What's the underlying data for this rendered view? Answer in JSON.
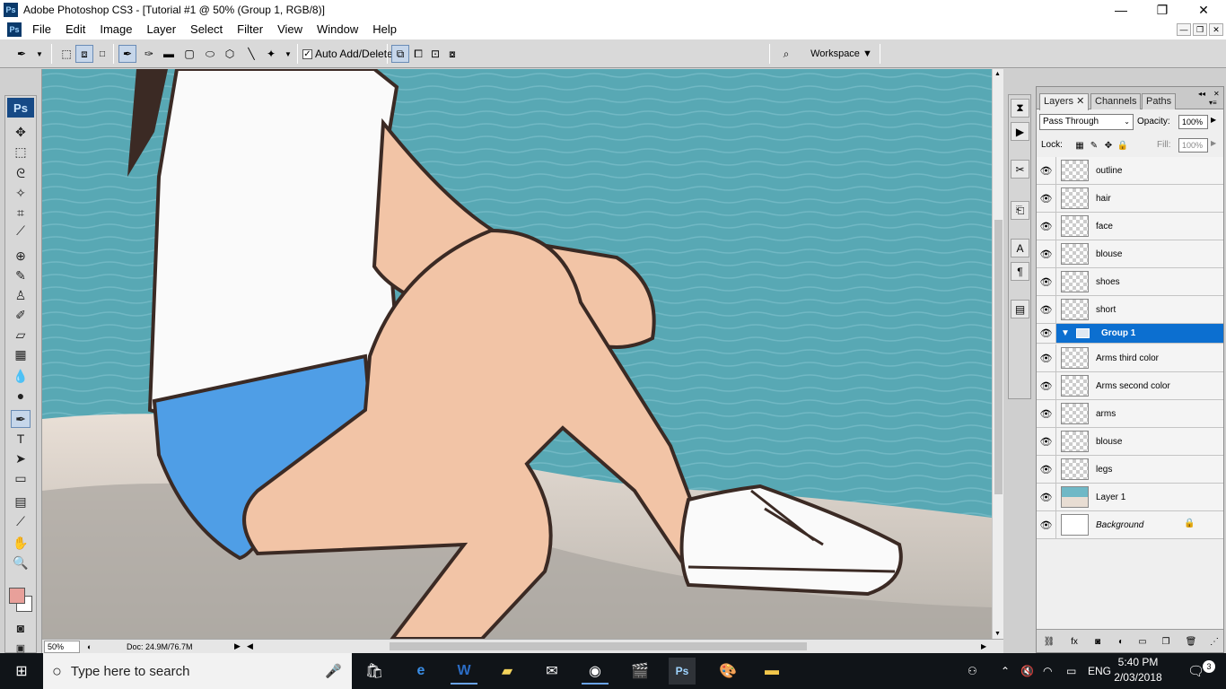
{
  "window": {
    "app_icon": "Ps",
    "title": "Adobe Photoshop CS3 - [Tutorial #1 @ 50% (Group 1, RGB/8)]",
    "controls": {
      "minimize": "—",
      "maximize": "❐",
      "close": "✕"
    }
  },
  "menubar": {
    "items": [
      "File",
      "Edit",
      "Image",
      "Layer",
      "Select",
      "Filter",
      "View",
      "Window",
      "Help"
    ],
    "mdi_controls": [
      "—",
      "❐",
      "✕"
    ]
  },
  "options_bar": {
    "auto_add_delete_label": "Auto Add/Delete",
    "auto_add_delete_checked": true,
    "workspace_label": "Workspace ▼"
  },
  "toolbox": {
    "logo": "Ps",
    "tools": [
      {
        "name": "move-tool",
        "glyph": "✥"
      },
      {
        "name": "marquee-tool",
        "glyph": "⬚"
      },
      {
        "name": "lasso-tool",
        "glyph": "ᘓ"
      },
      {
        "name": "magic-wand-tool",
        "glyph": "✧"
      },
      {
        "name": "crop-tool",
        "glyph": "⌗"
      },
      {
        "name": "slice-tool",
        "glyph": "⟋"
      },
      {
        "name": "healing-brush-tool",
        "glyph": "⊕"
      },
      {
        "name": "brush-tool",
        "glyph": "✎"
      },
      {
        "name": "clone-stamp-tool",
        "glyph": "♙"
      },
      {
        "name": "history-brush-tool",
        "glyph": "✐"
      },
      {
        "name": "eraser-tool",
        "glyph": "▱"
      },
      {
        "name": "gradient-tool",
        "glyph": "▦"
      },
      {
        "name": "blur-tool",
        "glyph": "💧"
      },
      {
        "name": "dodge-tool",
        "glyph": "●"
      },
      {
        "name": "pen-tool",
        "glyph": "✒"
      },
      {
        "name": "type-tool",
        "glyph": "T"
      },
      {
        "name": "path-selection-tool",
        "glyph": "➤"
      },
      {
        "name": "shape-tool",
        "glyph": "▭"
      },
      {
        "name": "notes-tool",
        "glyph": "▤"
      },
      {
        "name": "eyedropper-tool",
        "glyph": "⟋"
      },
      {
        "name": "hand-tool",
        "glyph": "✋"
      },
      {
        "name": "zoom-tool",
        "glyph": "🔍"
      }
    ],
    "selected_tool": "pen-tool",
    "foreground_color": "#e8a09a",
    "background_color": "#ffffff"
  },
  "status_bar": {
    "zoom": "50%",
    "doc_info": "Doc: 24.9M/76.7M"
  },
  "layers_panel": {
    "tabs": [
      {
        "label": "Layers",
        "active": true,
        "closable": true
      },
      {
        "label": "Channels",
        "active": false
      },
      {
        "label": "Paths",
        "active": false
      }
    ],
    "blend_mode": "Pass Through",
    "opacity_label": "Opacity:",
    "opacity": "100%",
    "lock_label": "Lock:",
    "fill_label": "Fill:",
    "fill": "100%",
    "layers": [
      {
        "name": "outline",
        "thumb": "transparent",
        "visible": true
      },
      {
        "name": "hair",
        "thumb": "transparent",
        "visible": true
      },
      {
        "name": "face",
        "thumb": "transparent",
        "visible": true
      },
      {
        "name": "blouse",
        "thumb": "transparent",
        "visible": true
      },
      {
        "name": "shoes",
        "thumb": "transparent",
        "visible": true
      },
      {
        "name": "short",
        "thumb": "transparent",
        "visible": true
      },
      {
        "name": "Group 1",
        "group": true,
        "selected": true,
        "visible": true
      },
      {
        "name": "Arms third color",
        "thumb": "transparent",
        "visible": true
      },
      {
        "name": "Arms second color",
        "thumb": "transparent",
        "visible": true
      },
      {
        "name": "arms",
        "thumb": "transparent",
        "visible": true
      },
      {
        "name": "blouse",
        "thumb": "transparent",
        "visible": true
      },
      {
        "name": "legs",
        "thumb": "transparent",
        "visible": true
      },
      {
        "name": "Layer 1",
        "thumb": "photo",
        "visible": true
      },
      {
        "name": "Background",
        "thumb": "white",
        "visible": true,
        "italic": true,
        "locked": true
      }
    ],
    "selection_color": "#0c6fd0"
  },
  "taskbar": {
    "search_placeholder": "Type here to search",
    "language": "ENG",
    "time": "5:40 PM",
    "date": "2/03/2018",
    "notification_count": "3"
  }
}
